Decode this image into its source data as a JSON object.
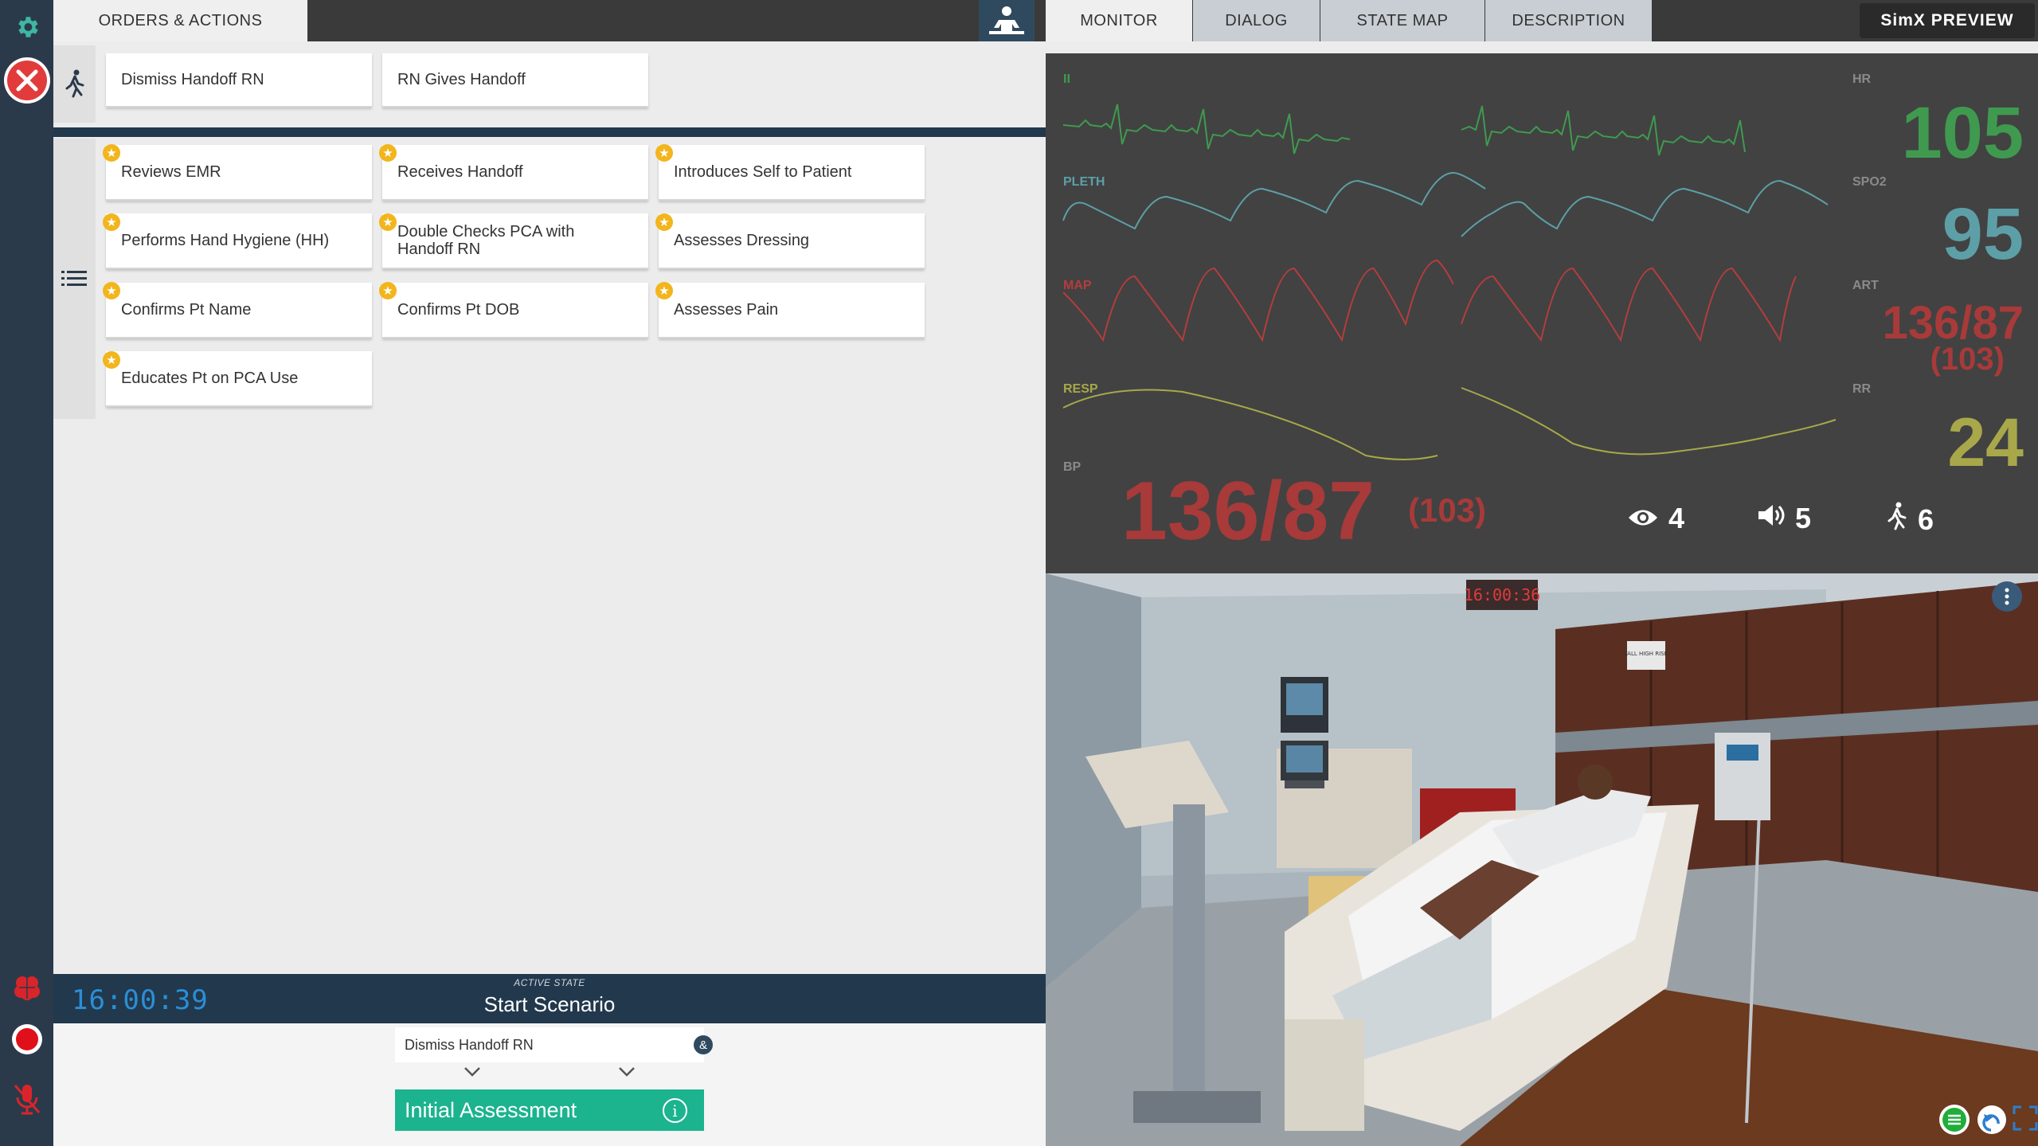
{
  "tabs": {
    "orders_actions": "ORDERS & ACTIONS",
    "monitor": "MONITOR",
    "dialog": "DIALOG",
    "state_map": "STATE MAP",
    "description": "DESCRIPTION",
    "preview": "SimX PREVIEW"
  },
  "handoff_actions": [
    "Dismiss Handoff RN",
    "RN Gives Handoff"
  ],
  "actions": {
    "row1": [
      "Reviews EMR",
      "Receives Handoff",
      "Introduces Self to Patient"
    ],
    "row2": [
      "Performs Hand Hygiene (HH)",
      "Double Checks PCA with Handoff RN",
      "Assesses Dressing"
    ],
    "row3": [
      "Confirms Pt Name",
      "Confirms Pt DOB",
      "Assesses Pain"
    ],
    "row4": [
      "Educates Pt on PCA Use"
    ]
  },
  "state": {
    "timer": "16:00:39",
    "active_label": "ACTIVE STATE",
    "active_name": "Start Scenario",
    "next_action": "Dismiss Handoff RN",
    "amp": "&",
    "next_state": "Initial Assessment",
    "info": "i"
  },
  "monitor": {
    "labels": {
      "ecg": "II",
      "pleth": "PLETH",
      "map": "MAP",
      "resp": "RESP",
      "bp": "BP",
      "hr": "HR",
      "spo2": "SPO2",
      "art": "ART",
      "rr": "RR"
    },
    "hr": "105",
    "spo2": "95",
    "art": "136/87",
    "art_mean": "(103)",
    "rr": "24",
    "bp": "136/87",
    "bp_mean": "(103)",
    "view_count": "4",
    "sound_count": "5",
    "action_count": "6",
    "colors": {
      "ecg": "#3f9a4f",
      "pleth": "#5d9fa7",
      "art": "#b43d3d",
      "resp": "#a8a84a"
    }
  },
  "scene": {
    "clock": "16:00:36",
    "sign": "FALL HIGH RISK"
  },
  "icons": [
    "gear-icon",
    "close-icon",
    "walking-person-icon",
    "list-icon",
    "patient-icon",
    "star-icon",
    "eye-icon",
    "speaker-icon",
    "brain-icon",
    "record-icon",
    "mic-off-icon",
    "chevron-down-icon",
    "info-icon",
    "undo-icon",
    "fullscreen-icon",
    "more-icon"
  ]
}
